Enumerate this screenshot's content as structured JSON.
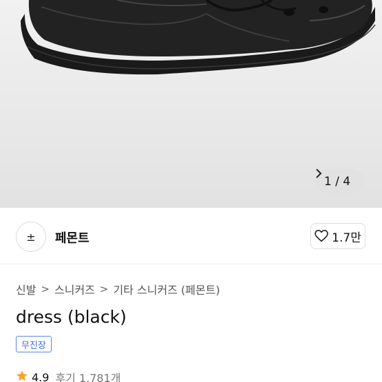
{
  "gallery": {
    "image_alt": "black leather sneaker",
    "counter_current": "1",
    "counter_sep": "/",
    "counter_total": "4",
    "next_icon": "chevron-right-icon"
  },
  "shop": {
    "avatar_symbol": "±",
    "name": "페몬트",
    "like_icon": "heart-outline-icon",
    "like_count": "1.7만"
  },
  "breadcrumb": {
    "items": [
      "신발",
      "스니커즈",
      "기타 스니커즈 (페몬트)"
    ],
    "separator": ">"
  },
  "product": {
    "title": "dress (black)",
    "badge": "무진장",
    "badge_color": "#3d6fe0"
  },
  "rating": {
    "star_color": "#f5a623",
    "score": "4.9",
    "reviews": "후기 1,781개"
  }
}
